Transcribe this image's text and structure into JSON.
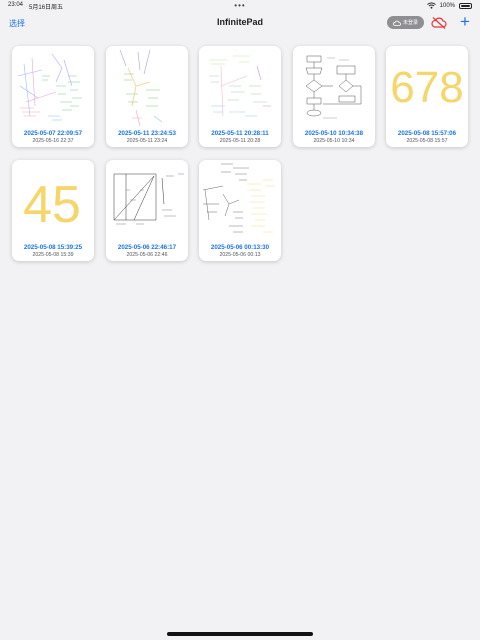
{
  "status": {
    "time": "23:04",
    "date": "5月16日周五",
    "battery": "100%"
  },
  "nav": {
    "select_label": "选择",
    "title": "InfinitePad",
    "sync_label": "未登录",
    "add_label": "+"
  },
  "notes": [
    {
      "title": "2025-05-07 22:09:57",
      "modified": "2025-05-16 22:37"
    },
    {
      "title": "2025-05-11 23:24:53",
      "modified": "2025-05-11 23:24"
    },
    {
      "title": "2025-05-11 20:28:11",
      "modified": "2025-05-11 20:28"
    },
    {
      "title": "2025-05-10 10:34:38",
      "modified": "2025-05-10 10:34"
    },
    {
      "title": "2025-05-08 15:57:06",
      "modified": "2025-05-08 15:57"
    },
    {
      "title": "2025-05-08 15:39:25",
      "modified": "2025-05-08 15:39"
    },
    {
      "title": "2025-05-06 22:46:17",
      "modified": "2025-05-06 22:46"
    },
    {
      "title": "2025-05-06 00:13:30",
      "modified": "2025-05-06 00:13"
    }
  ],
  "thumb_handwriting": {
    "note5": "678",
    "note6": "45"
  },
  "colors": {
    "accent": "#1a73e8",
    "highlighter": "#f6d56a",
    "alert_red": "#e53935"
  },
  "icons": {
    "wifi": "wifi-icon",
    "battery": "battery-icon",
    "cloud": "cloud-icon",
    "cloud_off": "cloud-off-icon",
    "add": "plus-icon"
  }
}
